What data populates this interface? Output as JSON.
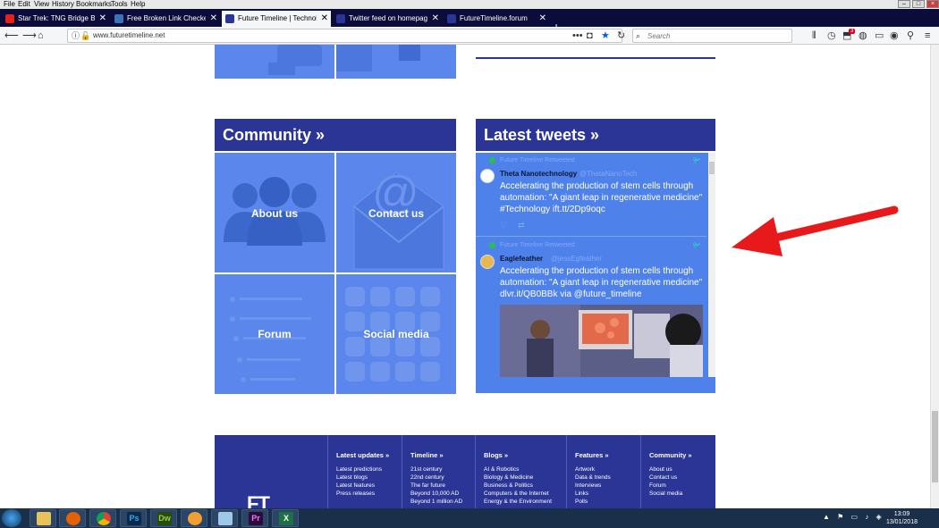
{
  "menubar": {
    "items": [
      {
        "label": "File",
        "ul": "F"
      },
      {
        "label": "Edit",
        "ul": "E"
      },
      {
        "label": "View",
        "ul": "V"
      },
      {
        "label": "History",
        "ul": "s"
      },
      {
        "label": "Bookmarks",
        "ul": "B"
      },
      {
        "label": "Tools",
        "ul": "T"
      },
      {
        "label": "Help",
        "ul": "H"
      }
    ]
  },
  "tabs": [
    {
      "title": "Star Trek: TNG Bridge Backgr",
      "icon": "youtube-icon",
      "color": "#e62117",
      "audio": true
    },
    {
      "title": "Free Broken Link Checker - che",
      "icon": "link-checker-icon",
      "color": "#3b73b9"
    },
    {
      "title": "Future Timeline | Technology |",
      "icon": "ft-icon",
      "color": "#2a3595",
      "active": true
    },
    {
      "title": "Twitter feed on homepage - Fu",
      "icon": "ft-forum-icon",
      "color": "#2a3595"
    },
    {
      "title": "FutureTimeline.forum",
      "icon": "ft-forum-icon",
      "color": "#2a3595"
    }
  ],
  "navbar": {
    "url": "www.futuretimeline.net",
    "search_placeholder": "Search",
    "badge_count": "3"
  },
  "community": {
    "heading": "Community »",
    "tiles": [
      {
        "label": "About us",
        "icon": "people-icon"
      },
      {
        "label": "Contact us",
        "icon": "envelope-at-icon"
      },
      {
        "label": "Forum",
        "icon": "forum-icon"
      },
      {
        "label": "Social media",
        "icon": "social-apps-icon"
      }
    ]
  },
  "tweets": {
    "heading": "Latest tweets »",
    "items": [
      {
        "retweet_label": "Future Timeline Retweeted",
        "name": "Theta Nanotechnology",
        "handle": "@ThetaNanoTech",
        "text": "Accelerating the production of stem cells through automation: \"A giant leap in regenerative medicine\" #Technology ift.tt/2Dp9oqc"
      },
      {
        "retweet_label": "Future Timeline Retweeted",
        "name": "Eaglefeather",
        "handle": "@jessEgfeather",
        "text": "Accelerating the production of stem cells through automation: \"A giant leap in regenerative medicine\" dlvr.it/QB0BBk via @future_timeline"
      }
    ]
  },
  "footer": {
    "logo": "FT",
    "columns": [
      {
        "heading": "Latest updates »",
        "items": [
          "Latest predictions",
          "Latest blogs",
          "Latest features",
          "Press releases"
        ]
      },
      {
        "heading": "Timeline »",
        "items": [
          "21st century",
          "22nd century",
          "The far future",
          "Beyond 10,000 AD",
          "Beyond 1 million AD"
        ]
      },
      {
        "heading": "Blogs »",
        "items": [
          "AI & Robotics",
          "Biology & Medicine",
          "Business & Politics",
          "Computers & the Internet",
          "Energy & the Environment"
        ]
      },
      {
        "heading": "Features »",
        "items": [
          "Artwork",
          "Data & trends",
          "Interviews",
          "Links",
          "Polls"
        ]
      },
      {
        "heading": "Community »",
        "items": [
          "About us",
          "Contact us",
          "Forum",
          "Social media"
        ]
      }
    ]
  },
  "taskbar": {
    "time": "13:09",
    "date": "13/01/2018",
    "apps": [
      {
        "icon": "file-explorer-icon",
        "glyph": "",
        "color": "#e8c35a"
      },
      {
        "icon": "firefox-icon",
        "glyph": "",
        "color": "#e66000"
      },
      {
        "icon": "chrome-icon",
        "glyph": "",
        "color": "#4caf50"
      },
      {
        "icon": "photoshop-icon",
        "glyph": "Ps",
        "color": "#0b2a4a"
      },
      {
        "icon": "dreamweaver-icon",
        "glyph": "Dw",
        "color": "#2a4a0b"
      },
      {
        "icon": "settings-gear-icon",
        "glyph": "",
        "color": "#f0a030"
      },
      {
        "icon": "notepad-icon",
        "glyph": "",
        "color": "#9fc7e8"
      },
      {
        "icon": "premiere-icon",
        "glyph": "Pr",
        "color": "#2a0b3a"
      },
      {
        "icon": "excel-icon",
        "glyph": "X",
        "color": "#1e7145"
      }
    ]
  }
}
